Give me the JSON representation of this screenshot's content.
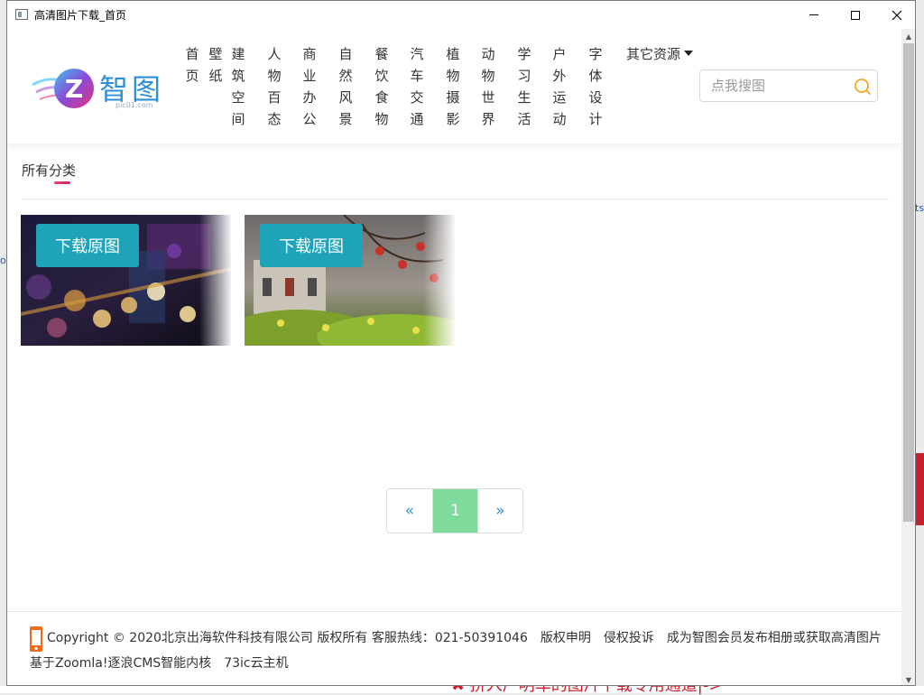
{
  "window": {
    "title": "高清图片下载_首页"
  },
  "background": {
    "bottom_text": "✖ 拼入广明车的图片下载专用通道|->",
    "left_mark": "o.",
    "right_mark": "ts"
  },
  "logo": {
    "name": "智图",
    "sub": "pic01.com"
  },
  "nav": {
    "items": [
      {
        "label": "首页"
      },
      {
        "label": "壁纸"
      },
      {
        "label": "建筑空间"
      },
      {
        "label": "人物百态"
      },
      {
        "label": "商业办公"
      },
      {
        "label": "自然风景"
      },
      {
        "label": "餐饮食物"
      },
      {
        "label": "汽车交通"
      },
      {
        "label": "植物摄影"
      },
      {
        "label": "动物世界"
      },
      {
        "label": "学习生活"
      },
      {
        "label": "户外运动"
      },
      {
        "label": "字体设计"
      }
    ],
    "more_label": "其它资源"
  },
  "search": {
    "placeholder": "点我搜图",
    "icon": "search-icon",
    "accent": "#f5a623"
  },
  "category": {
    "title": "所有分类"
  },
  "cards": [
    {
      "button": "下载原图"
    },
    {
      "button": "下载原图"
    }
  ],
  "pagination": {
    "prev": "«",
    "current": "1",
    "next": "»",
    "active_color": "#7fdb9c"
  },
  "footer": {
    "copyright": "Copyright © 2020北京出海软件科技有限公司 版权所有 客服热线：021-50391046",
    "links": [
      "版权申明",
      "侵权投诉",
      "成为智图会员发布相册或获取高清图片"
    ],
    "powered": "基于Zoomla!逐浪CMS智能内核",
    "host": "73ic云主机"
  },
  "colors": {
    "button": "#1fa3b8",
    "logo": "#2d8fd6",
    "category_underline": "#e8477b"
  }
}
